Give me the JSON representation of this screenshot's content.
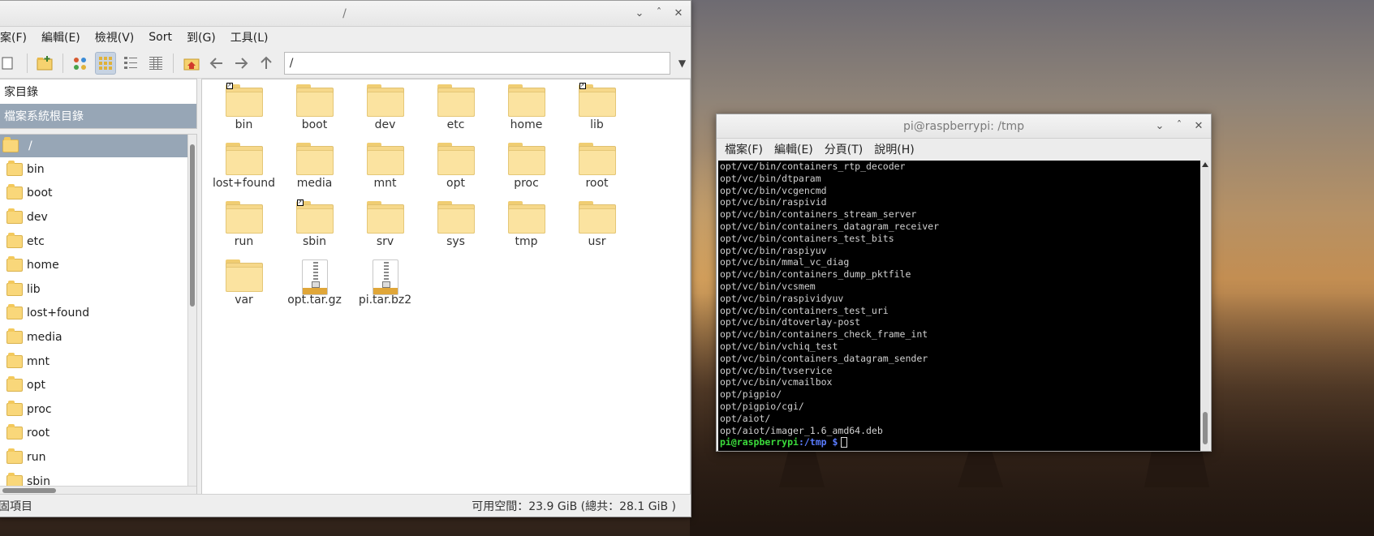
{
  "file_manager": {
    "title": "/",
    "menu": [
      "案(F)",
      "編輯(E)",
      "檢視(V)",
      "Sort",
      "到(G)",
      "工具(L)"
    ],
    "path": "/",
    "places": [
      {
        "label": "家目錄",
        "selected": false
      },
      {
        "label": "檔案系統根目錄",
        "selected": true
      }
    ],
    "tree_root": "/",
    "tree_items": [
      "bin",
      "boot",
      "dev",
      "etc",
      "home",
      "lib",
      "lost+found",
      "media",
      "mnt",
      "opt",
      "proc",
      "root",
      "run",
      "sbin"
    ],
    "files": [
      {
        "name": "bin",
        "type": "folder",
        "link": true
      },
      {
        "name": "boot",
        "type": "folder",
        "link": false
      },
      {
        "name": "dev",
        "type": "folder",
        "link": false
      },
      {
        "name": "etc",
        "type": "folder",
        "link": false
      },
      {
        "name": "home",
        "type": "folder",
        "link": false
      },
      {
        "name": "lib",
        "type": "folder",
        "link": true
      },
      {
        "name": "lost+found",
        "type": "folder",
        "link": false
      },
      {
        "name": "media",
        "type": "folder",
        "link": false
      },
      {
        "name": "mnt",
        "type": "folder",
        "link": false
      },
      {
        "name": "opt",
        "type": "folder",
        "link": false
      },
      {
        "name": "proc",
        "type": "folder",
        "link": false
      },
      {
        "name": "root",
        "type": "folder",
        "link": false
      },
      {
        "name": "run",
        "type": "folder",
        "link": false
      },
      {
        "name": "sbin",
        "type": "folder",
        "link": true
      },
      {
        "name": "srv",
        "type": "folder",
        "link": false
      },
      {
        "name": "sys",
        "type": "folder",
        "link": false
      },
      {
        "name": "tmp",
        "type": "folder",
        "link": false
      },
      {
        "name": "usr",
        "type": "folder",
        "link": false
      },
      {
        "name": "var",
        "type": "folder",
        "link": false
      },
      {
        "name": "opt.tar.gz",
        "type": "archive",
        "link": false
      },
      {
        "name": "pi.tar.bz2",
        "type": "archive",
        "link": false
      }
    ],
    "status_left": "固項目",
    "status_right": "可用空間：23.9 GiB (總共：28.1 GiB )"
  },
  "terminal": {
    "title": "pi@raspberrypi: /tmp",
    "menu": [
      "檔案(F)",
      "編輯(E)",
      "分頁(T)",
      "說明(H)"
    ],
    "lines": [
      "opt/vc/bin/containers_rtp_decoder",
      "opt/vc/bin/dtparam",
      "opt/vc/bin/vcgencmd",
      "opt/vc/bin/raspivid",
      "opt/vc/bin/containers_stream_server",
      "opt/vc/bin/containers_datagram_receiver",
      "opt/vc/bin/containers_test_bits",
      "opt/vc/bin/raspiyuv",
      "opt/vc/bin/mmal_vc_diag",
      "opt/vc/bin/containers_dump_pktfile",
      "opt/vc/bin/vcsmem",
      "opt/vc/bin/raspividyuv",
      "opt/vc/bin/containers_test_uri",
      "opt/vc/bin/dtoverlay-post",
      "opt/vc/bin/containers_check_frame_int",
      "opt/vc/bin/vchiq_test",
      "opt/vc/bin/containers_datagram_sender",
      "opt/vc/bin/tvservice",
      "opt/vc/bin/vcmailbox",
      "opt/pigpio/",
      "opt/pigpio/cgi/",
      "opt/aiot/",
      "opt/aiot/imager_1.6_amd64.deb"
    ],
    "prompt_user": "pi@raspberrypi",
    "prompt_path": ":/tmp",
    "prompt_sign": " $"
  }
}
